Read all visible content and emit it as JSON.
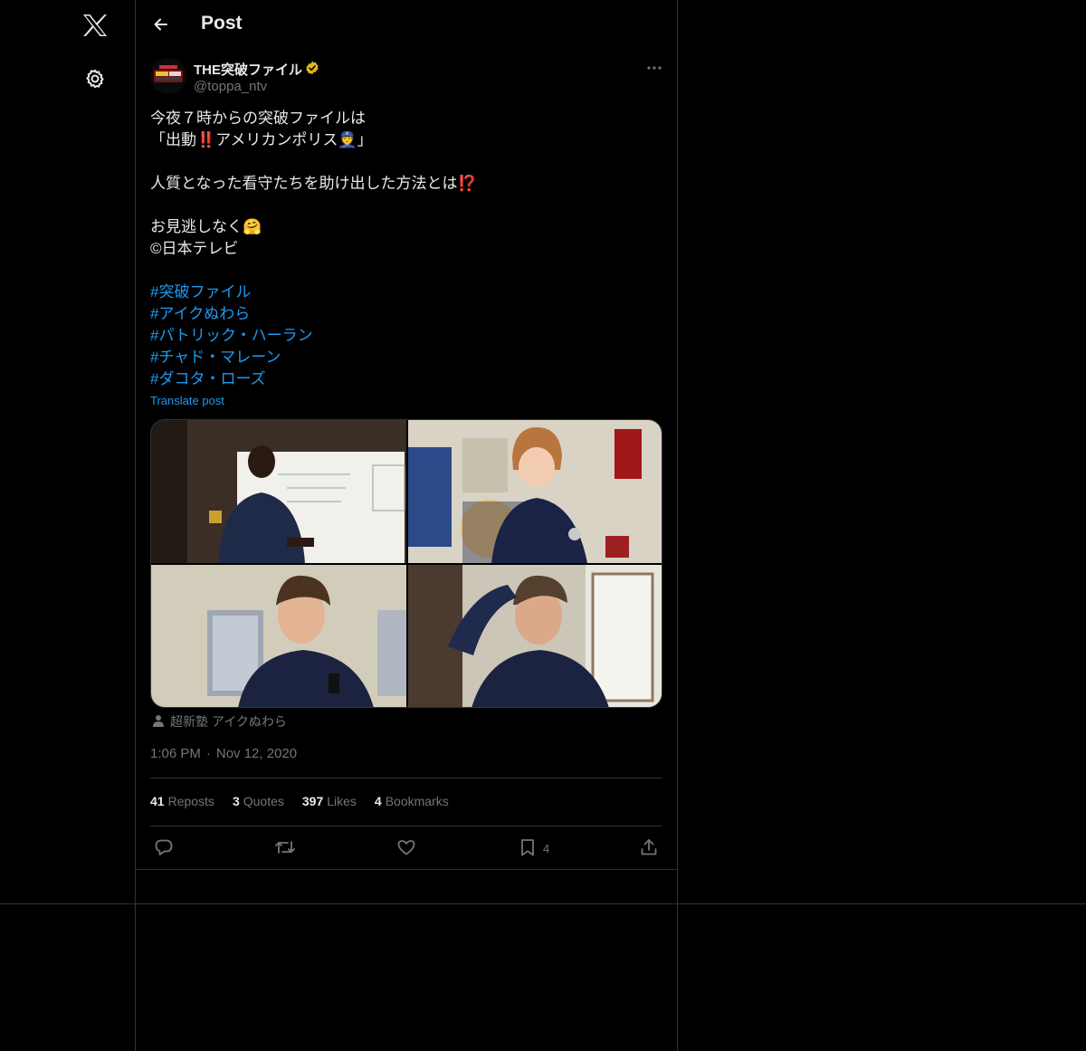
{
  "nav": {
    "logo_icon": "x-logo-icon",
    "settings_icon": "gear-icon"
  },
  "header": {
    "title": "Post",
    "back_icon": "arrow-left-icon"
  },
  "author": {
    "name": "THE突破ファイル",
    "handle": "@toppa_ntv",
    "verified_icon": "verified-badge-icon",
    "verified_color": "#e2b719",
    "more_icon": "more-horizontal-icon"
  },
  "post": {
    "lines": [
      "今夜７時からの突破ファイルは",
      "「出動‼️アメリカンポリス👮」",
      "",
      "人質となった看守たちを助け出した方法とは⁉️",
      "",
      "お見逃しなく🤗",
      "©日本テレビ",
      ""
    ],
    "hashtags": [
      "#突破ファイル",
      "#アイクぬわら",
      "#パトリック・ハーラン",
      "#チャド・マレーン",
      "#ダコタ・ローズ"
    ],
    "translate_label": "Translate post",
    "tagged_user": "超新塾 アイクぬわら",
    "time": "1:06 PM",
    "date": "Nov 12, 2020"
  },
  "stats": [
    {
      "count": "41",
      "label": "Reposts"
    },
    {
      "count": "3",
      "label": "Quotes"
    },
    {
      "count": "397",
      "label": "Likes"
    },
    {
      "count": "4",
      "label": "Bookmarks"
    }
  ],
  "actions": {
    "bookmark_count": "4"
  },
  "colors": {
    "link": "#1d9bf0",
    "muted": "#71767b",
    "border": "#2f3336"
  }
}
